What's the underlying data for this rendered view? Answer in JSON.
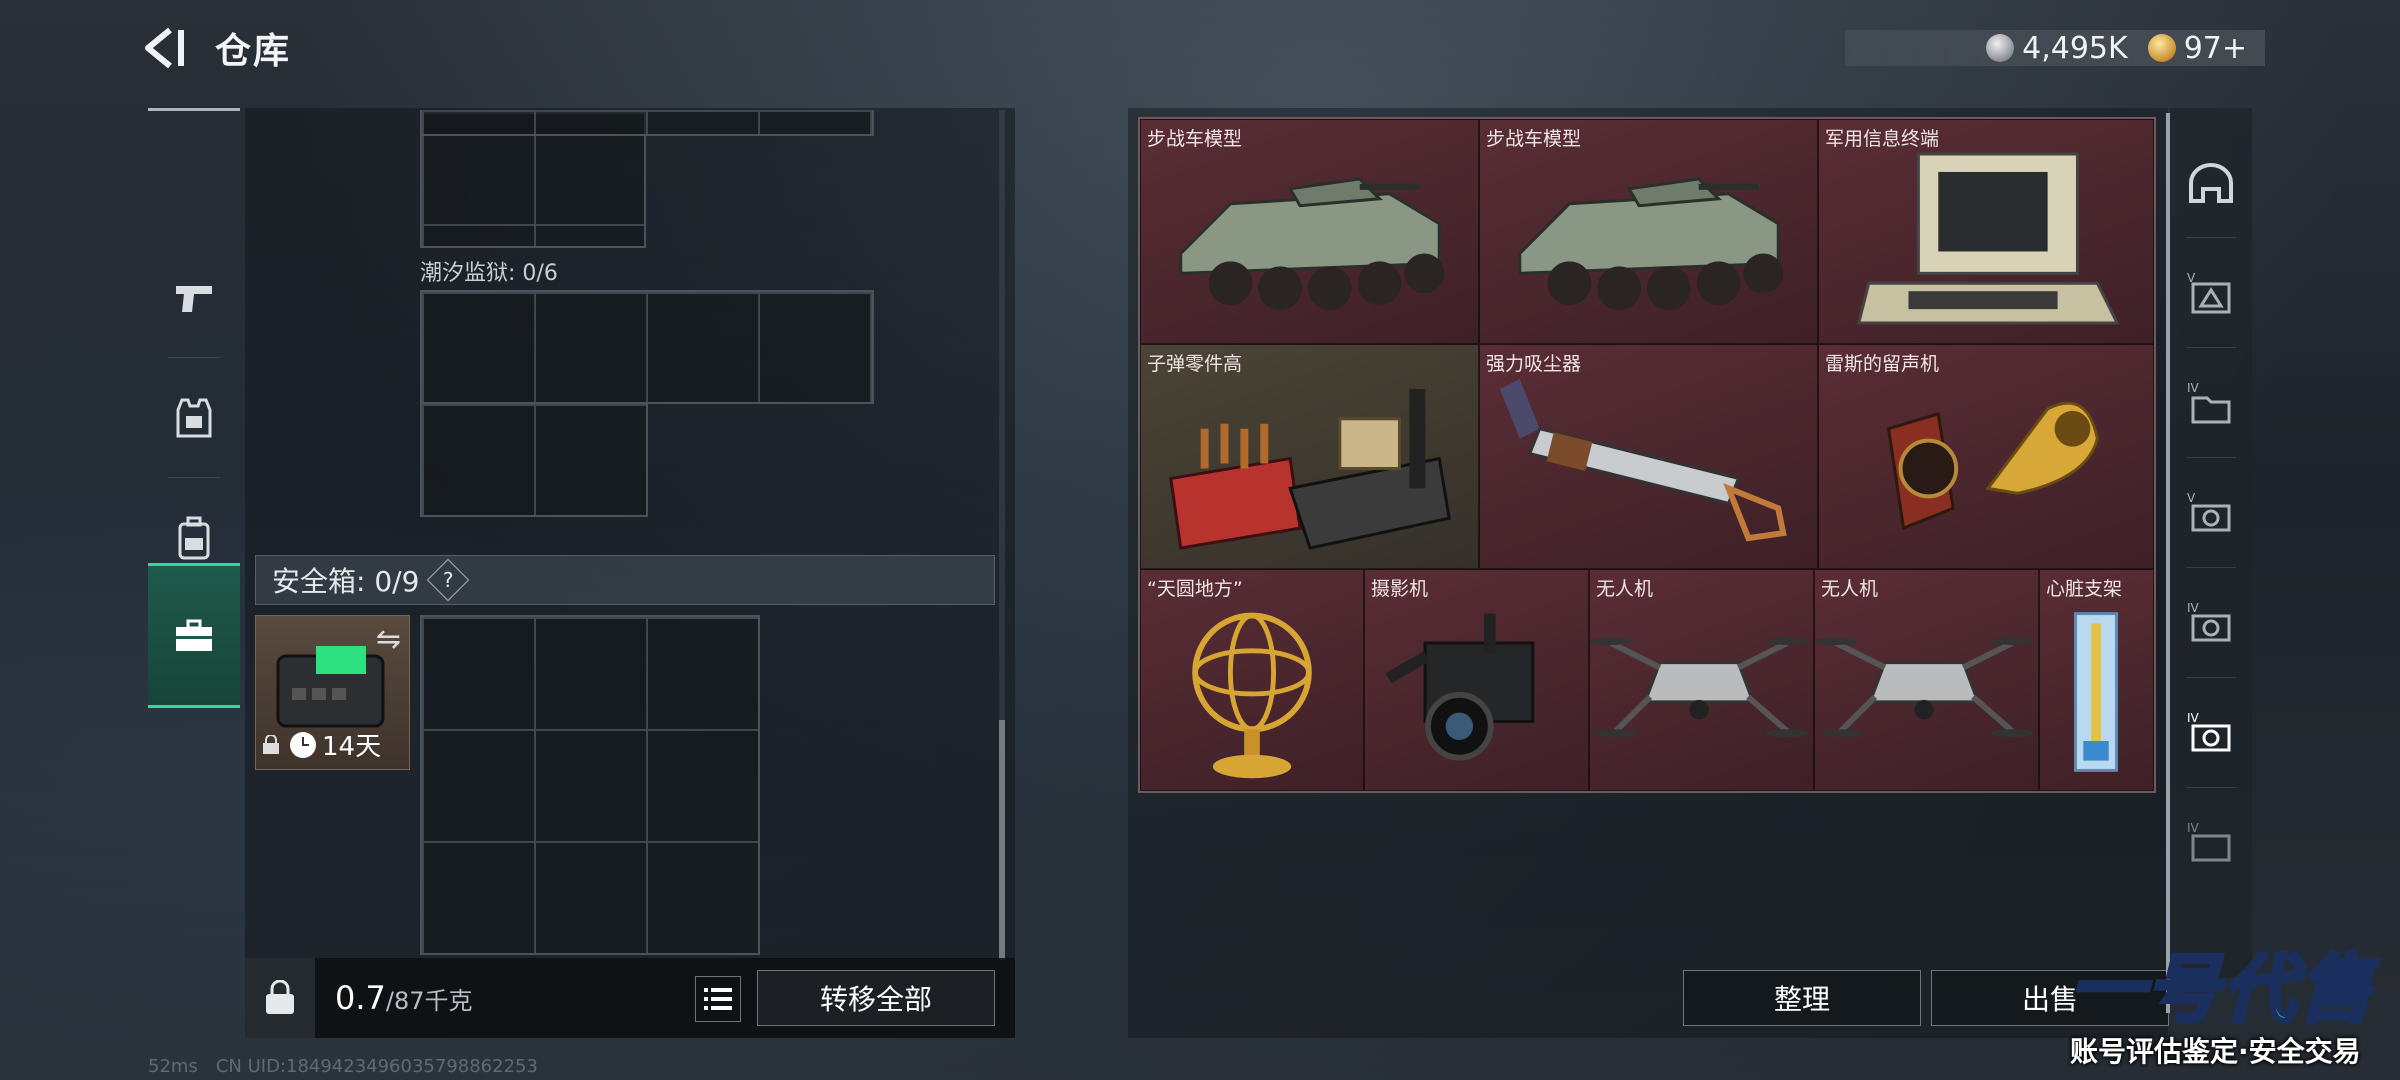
{
  "header": {
    "back_icon": "back-arrow-icon",
    "title": "仓库",
    "currencies": [
      {
        "icon": "silver-coin-icon",
        "value": "4,495K"
      },
      {
        "icon": "gold-coin-icon",
        "value": "97+"
      }
    ]
  },
  "left_rail": {
    "items": [
      {
        "icon": "pistol-icon",
        "active": false
      },
      {
        "icon": "armor-vest-icon",
        "active": false
      },
      {
        "icon": "backpack-icon",
        "active": false
      },
      {
        "icon": "briefcase-icon",
        "active": true
      }
    ]
  },
  "containers": {
    "tide_prison_label": "潮汐监狱: 0/6",
    "safe_box_label": "安全箱: 0/9",
    "safe_box_help": "?",
    "safe_box_timer": "14天"
  },
  "left_footer": {
    "weight_current": "0.7",
    "weight_max": "/87千克",
    "transfer_all_label": "转移全部"
  },
  "stash": {
    "items": [
      {
        "name": "步战车模型",
        "art": "ifv-model",
        "tone": "red"
      },
      {
        "name": "步战车模型",
        "art": "ifv-model",
        "tone": "red"
      },
      {
        "name": "军用信息终端",
        "art": "terminal",
        "tone": "red"
      },
      {
        "name": "子弹零件高",
        "art": "ammo-parts",
        "tone": "tan"
      },
      {
        "name": "强力吸尘器",
        "art": "vacuum",
        "tone": "red"
      },
      {
        "name": "雷斯的留声机",
        "art": "gramophone",
        "tone": "red"
      },
      {
        "name": "“天圆地方”",
        "art": "armillary",
        "tone": "red"
      },
      {
        "name": "摄影机",
        "art": "camera",
        "tone": "red"
      },
      {
        "name": "无人机",
        "art": "drone",
        "tone": "red"
      },
      {
        "name": "无人机",
        "art": "drone",
        "tone": "red"
      },
      {
        "name": "心脏支架",
        "art": "stent",
        "tone": "red"
      }
    ],
    "sort_label": "整理",
    "sell_label": "出售"
  },
  "right_rail": {
    "items": [
      "helmet-filter-icon",
      "level-v-filter-icon",
      "level-iv-folder-filter-icon",
      "level-v-camera-filter-icon",
      "level-iv-camera-filter-icon",
      "level-iv-camera-active-filter-icon",
      "level-iv-bottom-filter-icon"
    ]
  },
  "status": {
    "ping": "52ms",
    "uid": "CN UID:1849423496035798862253"
  },
  "watermark": {
    "title_a": "一号",
    "title_b": "代售",
    "subtitle": "账号评估鉴定·安全交易"
  },
  "colors": {
    "accent_green": "#35d6a1",
    "item_red": "#5a2d35",
    "item_tan": "#4b4436"
  }
}
